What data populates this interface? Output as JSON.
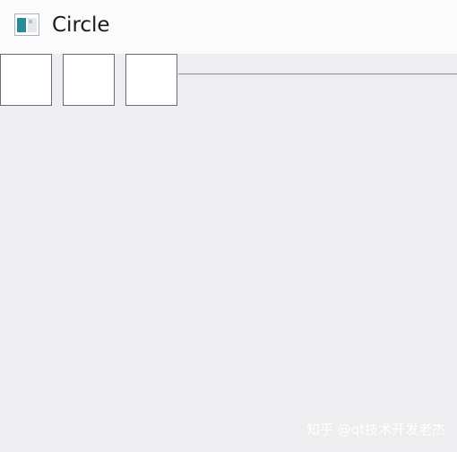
{
  "window": {
    "title": "Circle",
    "icon": "app-window-icon"
  },
  "toolbar": {
    "buttons": [
      {
        "name": "tool-button-1",
        "label": ""
      },
      {
        "name": "tool-button-2",
        "label": ""
      },
      {
        "name": "tool-button-3",
        "label": ""
      }
    ]
  },
  "watermark": {
    "text": "知乎 @qt技术开发老杰"
  },
  "colors": {
    "background": "#eeeef1",
    "titlebar": "#fbfbfc",
    "button_border": "#6b6b80",
    "button_fill": "#ffffff"
  }
}
